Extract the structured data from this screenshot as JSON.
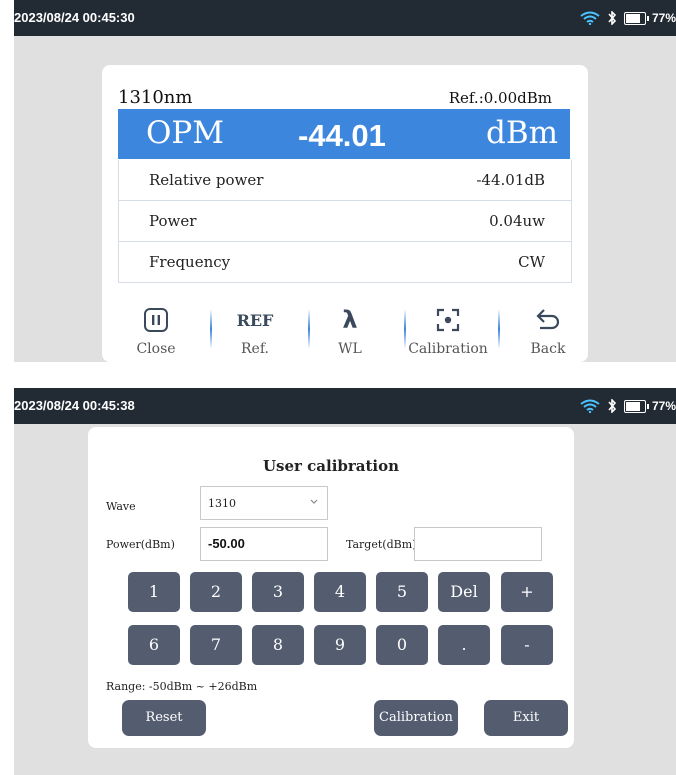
{
  "screen1": {
    "status": {
      "time": "2023/08/24 00:45:30",
      "battery": "77%",
      "battery_level": 0.77
    },
    "wavelength": "1310nm",
    "reference": "Ref.:0.00dBm",
    "opm": {
      "mode": "OPM",
      "value": "-44.01",
      "unit": "dBm"
    },
    "rows": [
      {
        "label": "Relative power",
        "value": "-44.01dB"
      },
      {
        "label": "Power",
        "value": "0.04uw"
      },
      {
        "label": "Frequency",
        "value": "CW"
      }
    ],
    "toolbar": [
      {
        "label": "Close",
        "icon": "pause-icon"
      },
      {
        "label": "Ref.",
        "icon": "ref-icon",
        "icon_text": "REF"
      },
      {
        "label": "WL",
        "icon": "lambda-icon",
        "icon_text": "λ"
      },
      {
        "label": "Calibration",
        "icon": "focus-icon"
      },
      {
        "label": "Back",
        "icon": "back-arrow-icon"
      }
    ]
  },
  "screen2": {
    "status": {
      "time": "2023/08/24 00:45:38",
      "battery": "77%",
      "battery_level": 0.77
    },
    "title": "User calibration",
    "wave_label": "Wave",
    "wave_value": "1310",
    "power_label": "Power(dBm)",
    "power_value": "-50.00",
    "target_label": "Target(dBm)",
    "target_value": "",
    "keys_row1": [
      "1",
      "2",
      "3",
      "4",
      "5",
      "Del",
      "+"
    ],
    "keys_row2": [
      "6",
      "7",
      "8",
      "9",
      "0",
      ".",
      "-"
    ],
    "range": "Range: -50dBm ~ +26dBm",
    "buttons": {
      "reset": "Reset",
      "calibration": "Calibration",
      "exit": "Exit"
    }
  },
  "colors": {
    "status_bar": "#222a33",
    "accent": "#3d86de",
    "key": "#545d70",
    "background": "#e0e0e0"
  }
}
